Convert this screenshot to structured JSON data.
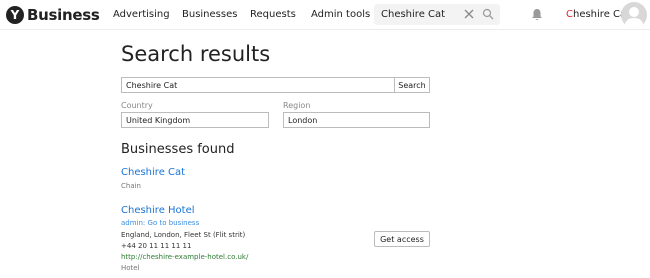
{
  "header": {
    "logo_letter": "Y",
    "logo_text": "Business",
    "nav": [
      "Advertising",
      "Businesses",
      "Requests",
      "Admin tools"
    ],
    "search_value": "Cheshire Cat",
    "user_first_letter": "C",
    "user_rest": "heshire Cat"
  },
  "main": {
    "title": "Search results",
    "search_value": "Cheshire Cat",
    "search_button": "Search",
    "country_label": "Country",
    "country_value": "United Kingdom",
    "region_label": "Region",
    "region_value": "London",
    "found_title": "Businesses found"
  },
  "results": [
    {
      "name": "Cheshire Cat",
      "category": "Chain"
    },
    {
      "name": "Cheshire Hotel",
      "admin_link": "admin: Go to business",
      "address": "England, London, Fleet St (Flit strit)",
      "phone": "+44 20 11 11 11 11",
      "url": "http://cheshire-example-hotel.co.uk/",
      "category": "Hotel",
      "access_button": "Get access"
    }
  ],
  "colors": {
    "link": "#1a73d6",
    "url": "#2e7d32",
    "user_accent": "#e0242b"
  }
}
